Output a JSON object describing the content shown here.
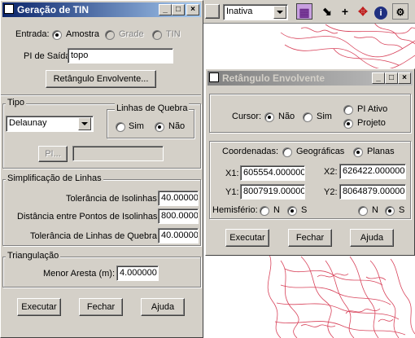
{
  "tin_window": {
    "title": "Geração de TIN",
    "entrada_label": "Entrada:",
    "entrada_options": [
      "Amostra",
      "Grade",
      "TIN"
    ],
    "pi_saida_label": "PI de Saída:",
    "pi_saida_value": "topo",
    "retangulo_button": "Retângulo Envolvente...",
    "tipo_legend": "Tipo",
    "tipo_value": "Delaunay",
    "linhas_quebra_legend": "Linhas de Quebra",
    "sim_label": "Sim",
    "nao_label": "Não",
    "pi_button": "PI...",
    "simplificacao_legend": "Simplificação de Linhas",
    "tolerancia_isolinhas_label": "Tolerância de Isolinhas:",
    "tolerancia_isolinhas_value": "40.00000",
    "distancia_label": "Distância entre Pontos de Isolinhas:",
    "distancia_value": "800.0000",
    "tolerancia_quebra_label": "Tolerância de Linhas de Quebra:",
    "tolerancia_quebra_value": "40.00000",
    "triangulacao_legend": "Triangulação",
    "menor_aresta_label": "Menor Aresta (m):",
    "menor_aresta_value": "4.000000",
    "executar": "Executar",
    "fechar": "Fechar",
    "ajuda": "Ajuda"
  },
  "map_toolbar": {
    "layer_select": "Inativa"
  },
  "ret_window": {
    "title": "Retângulo Envolvente",
    "cursor_label": "Cursor:",
    "nao": "Não",
    "sim": "Sim",
    "pi_ativo": "PI Ativo",
    "projeto": "Projeto",
    "coordenadas_label": "Coordenadas:",
    "geograficas": "Geográficas",
    "planas": "Planas",
    "x1_label": "X1:",
    "x1_value": "605554.000000",
    "x2_label": "X2:",
    "x2_value": "626422.000000",
    "y1_label": "Y1:",
    "y1_value": "8007919.000000",
    "y2_label": "Y2:",
    "y2_value": "8064879.000000",
    "hemisferio_label": "Hemisfério:",
    "n": "N",
    "s": "S",
    "executar": "Executar",
    "fechar": "Fechar",
    "ajuda": "Ajuda"
  },
  "colors": {
    "contour": "#d8425a",
    "title_active": "#0a246a",
    "title_inactive": "#808080"
  }
}
